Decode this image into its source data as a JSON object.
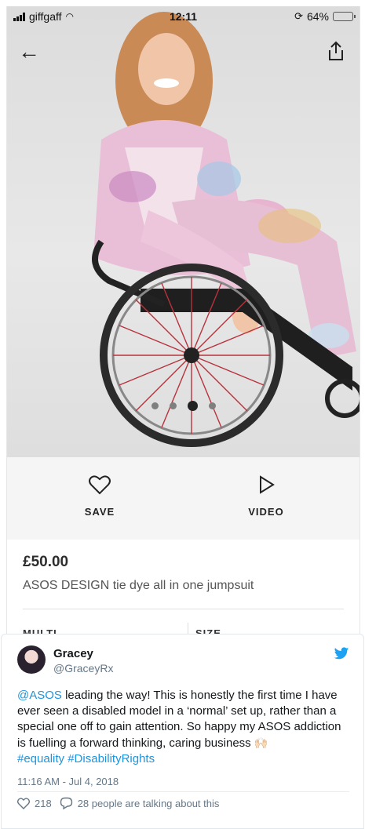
{
  "screenshot": {
    "status": {
      "carrier": "giffgaff",
      "time": "12:11",
      "battery": "64%",
      "battery_level": 0.64
    },
    "icons": {
      "back": "back-arrow-icon",
      "share": "share-icon"
    },
    "carousel": {
      "count": 4,
      "active_index": 2
    },
    "actions": {
      "save_label": "SAVE",
      "video_label": "VIDEO"
    },
    "product": {
      "price": "£50.00",
      "name": "ASOS DESIGN tie dye all in one jumpsuit",
      "select_1": "MULTI",
      "select_2": "SIZE"
    }
  },
  "tweet": {
    "display_name": "Gracey",
    "handle": "@GraceyRx",
    "text_parts": {
      "mention": "@ASOS",
      "body": " leading the way! This is honestly the first time I have ever seen a disabled model in a ‘normal’ set up, rather than a special one off to gain attention. So happy my ASOS addiction is fuelling a forward thinking, caring business ",
      "emoji": "🙌🏻",
      "hashtag1": "#equality",
      "hashtag2": "#DisabilityRights"
    },
    "timestamp": "11:16 AM - Jul 4, 2018",
    "likes": "218",
    "conversation": "28 people are talking about this",
    "colors": {
      "link": "#1b95e0",
      "meta": "#657786"
    }
  }
}
